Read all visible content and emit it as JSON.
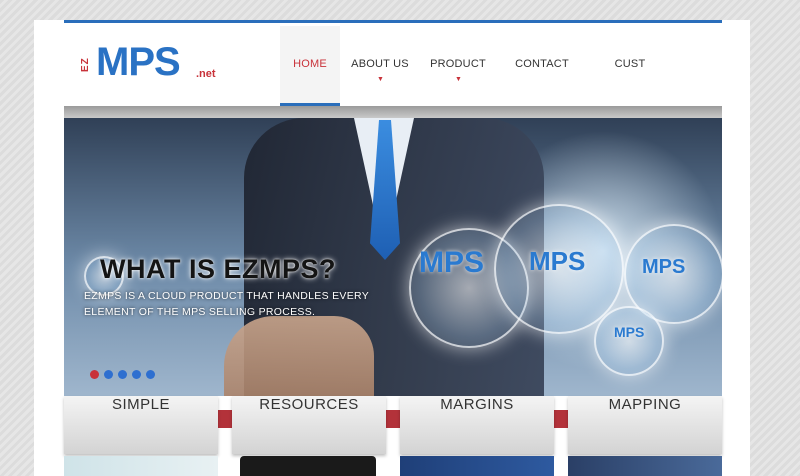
{
  "logo": {
    "ez": "EZ",
    "mps": "MPS",
    "net": ".net"
  },
  "nav": [
    {
      "label": "HOME",
      "active": true
    },
    {
      "label": "ABOUT US",
      "has_dropdown": true
    },
    {
      "label": "PRODUCT",
      "has_dropdown": true
    },
    {
      "label": "CONTACT US"
    },
    {
      "label": "CUST LOGIN"
    }
  ],
  "hero": {
    "title": "WHAT IS EZMPS?",
    "description": "EZMPS IS A CLOUD PRODUCT THAT HANDLES EVERY ELEMENT OF THE MPS SELLING PROCESS.",
    "bubble_logo_text": "MPS",
    "slide_count": 5,
    "active_slide": 1
  },
  "features": [
    {
      "label": "SIMPLE"
    },
    {
      "label": "RESOURCES"
    },
    {
      "label": "MARGINS"
    },
    {
      "label": "MAPPING"
    }
  ],
  "colors": {
    "accent_blue": "#2a6ebb",
    "accent_red": "#c8323a",
    "feature_bar_red": "#b3323a"
  }
}
